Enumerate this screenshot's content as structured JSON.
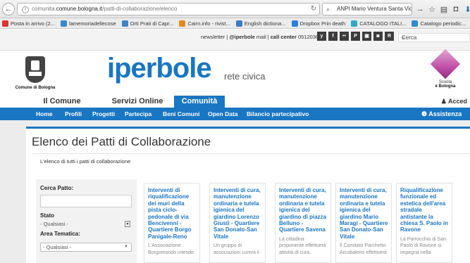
{
  "browser": {
    "url_prefix": "comunita.",
    "url_host": "comune.bologna.it",
    "url_path": "/patti-di-collaborazione/elenco",
    "search_value": "ANPI Mario Ventura Santa Viola",
    "bookmarks": [
      {
        "label": "Posta in arrivo (2...",
        "icon": "gmail-icon",
        "color": "#d33"
      },
      {
        "label": "lamemoriadellecose",
        "icon": "wordpress-icon",
        "color": "#3a86c8"
      },
      {
        "label": "Orti Prati di Capr...",
        "icon": "wordpress-icon",
        "color": "#3a86c8"
      },
      {
        "label": "Cairn.info - rivist...",
        "icon": "cairn-icon",
        "color": "#e08a1a"
      },
      {
        "label": "English  dictiona...",
        "icon": "globe-icon",
        "color": "#3d79c0"
      },
      {
        "label": "Dropbox Prin death",
        "icon": "dropbox-icon",
        "color": "#2a7ee0"
      },
      {
        "label": "CATALOGO ITALI...",
        "icon": "catalog-icon",
        "color": "#35a6c9"
      },
      {
        "label": "Catalogo periodic...",
        "icon": "catalog-icon",
        "color": "#2e8bd3"
      }
    ]
  },
  "header": {
    "top_links_pre": "newsletter | ",
    "top_links_iperbole": "@iperbole",
    "top_links_mid": " mail | ",
    "top_links_call": "call center",
    "top_links_phone": " 051203040",
    "social": [
      "y",
      "f",
      "••",
      "P",
      "▣",
      "◙",
      "R"
    ],
    "search_placeholder": "Cerca",
    "comune_label": "Comune di Bologna",
    "brand": "iperbole",
    "brand_sub": "rete civica",
    "scuola_l1": "Scuola",
    "scuola_l2": "è Bologna"
  },
  "nav": {
    "tabs": [
      "Il Comune",
      "Servizi Online",
      "Comunità"
    ],
    "active_tab": "Comunità",
    "login": "Acced",
    "sub": [
      "Home",
      "Profili",
      "Progetti",
      "Partecipa",
      "Beni Comuni",
      "Open Data",
      "Bilancio partecipativo"
    ],
    "assist": "Assistenza"
  },
  "page": {
    "title": "Elenco dei Patti di Collaborazione",
    "intro": "L'elenco di tutti i patti di collaborazione"
  },
  "filters": {
    "cerca_label": "Cerca Patto:",
    "cerca_value": "",
    "stato_label": "Stato",
    "stato_value": "- Qualsiasi -",
    "area_label": "Area Tematica:",
    "area_value": "- Qualsiasi -"
  },
  "cards": [
    {
      "title_lines": [
        "Interventi di",
        "riqualificazione",
        "dei muri della",
        "pista ciclo-",
        "pedonale di via",
        "Bencivenni -",
        "Quartiere Borgo",
        "Panigale-Reno"
      ],
      "desc_lines": [
        "L'Associazione",
        "Borgomondo intende"
      ]
    },
    {
      "title_lines": [
        "Interventi di cura,",
        "manutenzione",
        "ordinaria e tutela",
        "igienica del",
        "giardino Lorenzo",
        "Giusti - Quartiere",
        "San Donato-San",
        "Vitale"
      ],
      "desc_lines": [
        "Un gruppo di",
        "associazioni curerà il"
      ]
    },
    {
      "title_lines": [
        "Interventi di cura,",
        "manutenzione",
        "ordinaria e tutela",
        "igienica del",
        "giardino di piazza",
        "Belluno -",
        "Quartiere Savena"
      ],
      "desc_lines": [
        "La cittadina",
        "proponente effettuerà",
        "attività di cura,"
      ]
    },
    {
      "title_lines": [
        "Interventi di cura,",
        "manutenzione",
        "ordinaria e tutela",
        "igienica del",
        "giardino Mario",
        "Maragi - Quartiere",
        "San Donato-San",
        "Vitale"
      ],
      "desc_lines": [
        "Il Comitato Parchetto",
        "Arcobaleno effettuerà"
      ]
    },
    {
      "title_lines": [
        "Riqualificazione",
        "funzionale ed",
        "estetica dell'area",
        "stradale",
        "antistante la",
        "chiesa S. Paolo in",
        "Ravone"
      ],
      "desc_lines": [
        "La Parrocchia di San",
        "Paolo di Ravone si",
        "impegna nella"
      ]
    }
  ]
}
